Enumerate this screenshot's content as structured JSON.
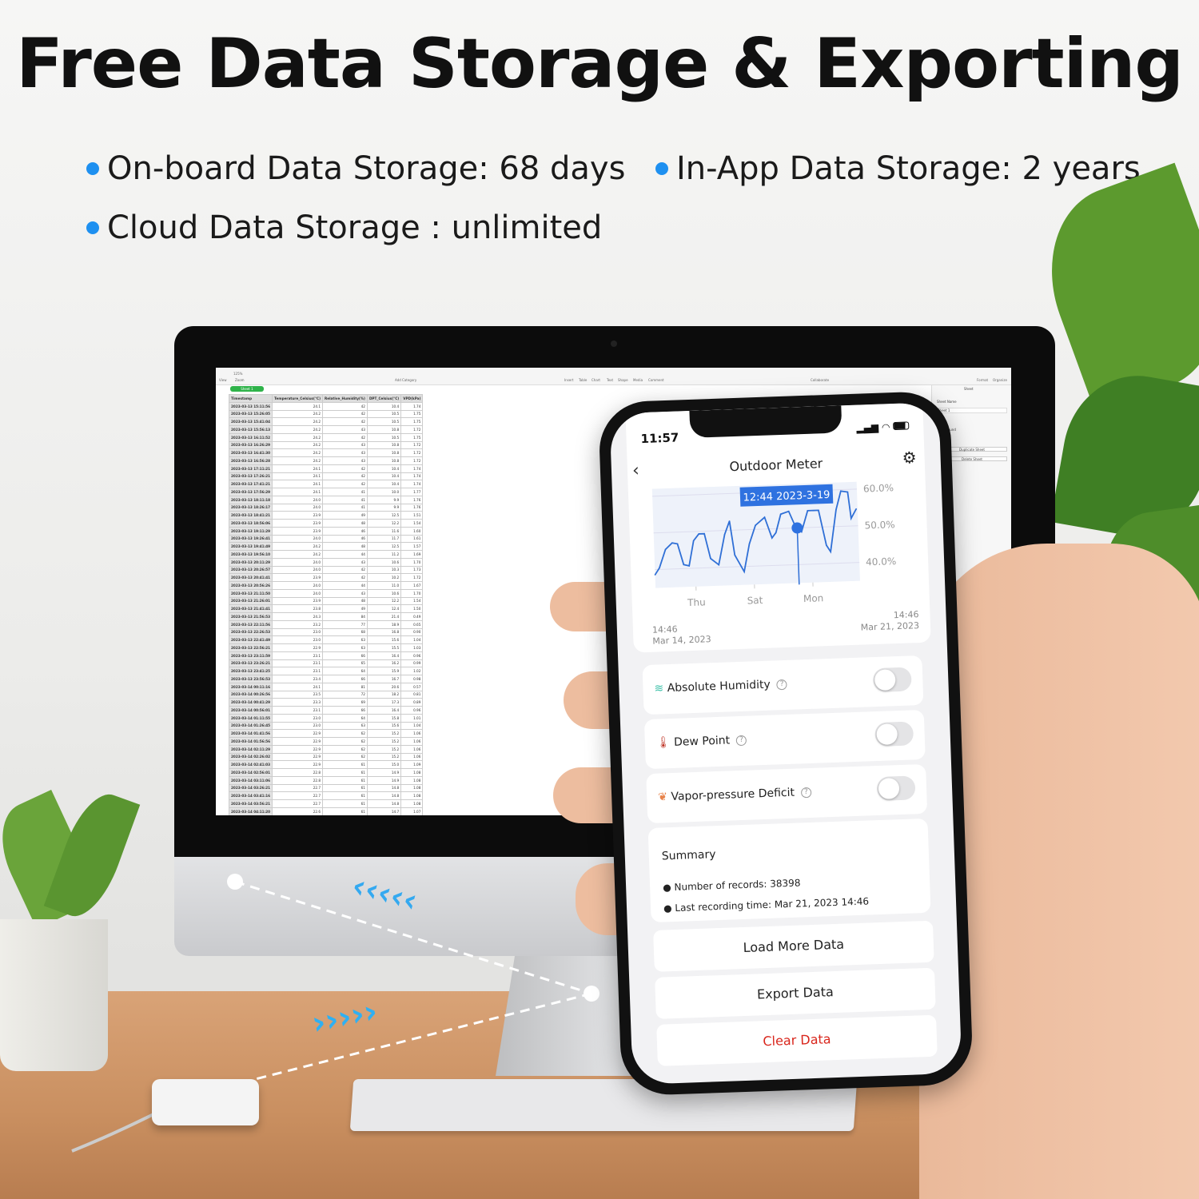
{
  "headline": "Free Data Storage & Exporting",
  "features": [
    "On-board Data Storage: 68 days",
    "In-App Data Storage: 2 years",
    "Cloud Data Storage : unlimited"
  ],
  "colors": {
    "accent": "#1e90f0",
    "chart_line": "#2f6fd6",
    "danger": "#d9261c",
    "toggle_off": "#e4e4e6"
  },
  "spreadsheet": {
    "toolbar": {
      "view": "View",
      "zoom_value": "125%",
      "zoom": "Zoom",
      "add_category": "Add Category",
      "insert": "Insert",
      "table": "Table",
      "chart": "Chart",
      "text": "Text",
      "shape": "Shape",
      "media": "Media",
      "comment": "Comment",
      "collaborate": "Collaborate",
      "format": "Format",
      "organize": "Organize"
    },
    "sheet_tab": "Sheet 1",
    "sidebar": {
      "title": "Sheet",
      "sheet_name_label": "Sheet Name",
      "sheet_name_value": "Sheet 1",
      "background": "Background",
      "duplicate": "Duplicate Sheet",
      "delete": "Delete Sheet"
    },
    "columns": [
      "Timestamp",
      "Temperature_Celsius(°C)",
      "Relative_Humidity(%)",
      "DPT_Celsius(°C)",
      "VPD(kPa)"
    ],
    "rows": [
      [
        "2023-03-13 15:11:56",
        "24.1",
        "42",
        "10.4",
        "1.74"
      ],
      [
        "2023-03-13 15:26:05",
        "24.2",
        "42",
        "10.5",
        "1.75"
      ],
      [
        "2023-03-13 15:41:04",
        "24.2",
        "42",
        "10.5",
        "1.75"
      ],
      [
        "2023-03-13 15:56:13",
        "24.2",
        "43",
        "10.8",
        "1.72"
      ],
      [
        "2023-03-13 16:11:52",
        "24.2",
        "42",
        "10.5",
        "1.75"
      ],
      [
        "2023-03-13 16:26:29",
        "24.2",
        "43",
        "10.8",
        "1.72"
      ],
      [
        "2023-03-13 16:41:30",
        "24.2",
        "43",
        "10.8",
        "1.72"
      ],
      [
        "2023-03-13 16:56:28",
        "24.2",
        "43",
        "10.8",
        "1.72"
      ],
      [
        "2023-03-13 17:11:21",
        "24.1",
        "42",
        "10.4",
        "1.74"
      ],
      [
        "2023-03-13 17:26:21",
        "24.1",
        "42",
        "10.4",
        "1.74"
      ],
      [
        "2023-03-13 17:41:21",
        "24.1",
        "42",
        "10.4",
        "1.74"
      ],
      [
        "2023-03-13 17:56:29",
        "24.1",
        "41",
        "10.0",
        "1.77"
      ],
      [
        "2023-03-13 18:11:18",
        "24.0",
        "41",
        "9.9",
        "1.76"
      ],
      [
        "2023-03-13 18:26:17",
        "24.0",
        "41",
        "9.9",
        "1.76"
      ],
      [
        "2023-03-13 18:41:21",
        "23.9",
        "49",
        "12.5",
        "1.51"
      ],
      [
        "2023-03-13 18:56:06",
        "23.9",
        "48",
        "12.2",
        "1.54"
      ],
      [
        "2023-03-13 19:11:29",
        "23.9",
        "46",
        "11.6",
        "1.60"
      ],
      [
        "2023-03-13 19:26:41",
        "24.0",
        "46",
        "11.7",
        "1.61"
      ],
      [
        "2023-03-13 19:41:49",
        "24.2",
        "48",
        "12.5",
        "1.57"
      ],
      [
        "2023-03-13 19:56:10",
        "24.2",
        "44",
        "11.2",
        "1.69"
      ],
      [
        "2023-03-13 20:11:29",
        "24.0",
        "43",
        "10.6",
        "1.70"
      ],
      [
        "2023-03-13 20:26:57",
        "24.0",
        "42",
        "10.3",
        "1.73"
      ],
      [
        "2023-03-13 20:41:41",
        "23.9",
        "42",
        "10.2",
        "1.72"
      ],
      [
        "2023-03-13 20:56:26",
        "24.0",
        "44",
        "11.0",
        "1.67"
      ],
      [
        "2023-03-13 21:11:50",
        "24.0",
        "43",
        "10.6",
        "1.70"
      ],
      [
        "2023-03-13 21:26:01",
        "23.9",
        "48",
        "12.2",
        "1.54"
      ],
      [
        "2023-03-13 21:41:41",
        "23.8",
        "49",
        "12.4",
        "1.50"
      ],
      [
        "2023-03-13 21:56:53",
        "24.3",
        "84",
        "21.4",
        "0.49"
      ],
      [
        "2023-03-13 22:11:56",
        "23.2",
        "77",
        "18.9",
        "0.65"
      ],
      [
        "2023-03-13 22:26:53",
        "23.0",
        "68",
        "16.8",
        "0.90"
      ],
      [
        "2023-03-13 22:41:49",
        "23.0",
        "63",
        "15.6",
        "1.04"
      ],
      [
        "2023-03-13 22:56:21",
        "22.9",
        "63",
        "15.5",
        "1.03"
      ],
      [
        "2023-03-13 23:11:59",
        "23.1",
        "66",
        "16.4",
        "0.96"
      ],
      [
        "2023-03-13 23:26:21",
        "23.1",
        "65",
        "16.2",
        "0.99"
      ],
      [
        "2023-03-13 23:41:25",
        "23.1",
        "64",
        "15.9",
        "1.02"
      ],
      [
        "2023-03-13 23:56:53",
        "23.4",
        "66",
        "16.7",
        "0.98"
      ],
      [
        "2023-03-14 00:11:16",
        "24.1",
        "81",
        "20.6",
        "0.57"
      ],
      [
        "2023-03-14 00:26:56",
        "23.5",
        "72",
        "18.2",
        "0.81"
      ],
      [
        "2023-03-14 00:41:29",
        "23.3",
        "69",
        "17.3",
        "0.89"
      ],
      [
        "2023-03-14 00:56:01",
        "23.1",
        "66",
        "16.4",
        "0.96"
      ],
      [
        "2023-03-14 01:11:55",
        "23.0",
        "64",
        "15.8",
        "1.01"
      ],
      [
        "2023-03-14 01:26:45",
        "23.0",
        "63",
        "15.6",
        "1.04"
      ],
      [
        "2023-03-14 01:41:56",
        "22.9",
        "62",
        "15.2",
        "1.06"
      ],
      [
        "2023-03-14 01:56:56",
        "22.9",
        "62",
        "15.2",
        "1.06"
      ],
      [
        "2023-03-14 02:11:29",
        "22.9",
        "62",
        "15.2",
        "1.06"
      ],
      [
        "2023-03-14 02:26:02",
        "22.9",
        "62",
        "15.2",
        "1.06"
      ],
      [
        "2023-03-14 02:41:03",
        "22.9",
        "61",
        "15.0",
        "1.09"
      ],
      [
        "2023-03-14 02:56:01",
        "22.8",
        "61",
        "14.9",
        "1.08"
      ],
      [
        "2023-03-14 03:11:06",
        "22.8",
        "61",
        "14.9",
        "1.08"
      ],
      [
        "2023-03-14 03:26:21",
        "22.7",
        "61",
        "14.8",
        "1.08"
      ],
      [
        "2023-03-14 03:41:16",
        "22.7",
        "61",
        "14.8",
        "1.08"
      ],
      [
        "2023-03-14 03:56:21",
        "22.7",
        "61",
        "14.8",
        "1.08"
      ],
      [
        "2023-03-14 04:11:20",
        "22.6",
        "61",
        "14.7",
        "1.07"
      ]
    ]
  },
  "phone": {
    "status_time": "11:57",
    "title": "Outdoor Meter",
    "icons": {
      "back": "chevron-left-icon",
      "settings": "gear-icon"
    },
    "range_start": {
      "time": "14:46",
      "date": "Mar 14, 2023"
    },
    "range_end": {
      "time": "14:46",
      "date": "Mar 21, 2023"
    },
    "toggles": [
      {
        "label": "Absolute Humidity",
        "icon": "humidity-wind-icon",
        "on": false
      },
      {
        "label": "Dew Point",
        "icon": "dew-point-thermometer-icon",
        "on": false
      },
      {
        "label": "Vapor-pressure Deficit",
        "icon": "leaf-icon",
        "on": false
      }
    ],
    "summary": {
      "title": "Summary",
      "records_label": "Number of records:",
      "records_value": "38398",
      "last_label": "Last recording time:",
      "last_value": "Mar 21, 2023 14:46"
    },
    "buttons": {
      "load_more": "Load More Data",
      "export": "Export Data",
      "clear": "Clear Data"
    }
  },
  "chart_data": {
    "type": "line",
    "title": "",
    "xlabel": "",
    "ylabel": "",
    "x_ticks": [
      {
        "label": "Thu",
        "date": "2023-03-16 00:00"
      },
      {
        "label": "Sat",
        "date": "2023-03-18 00:00"
      },
      {
        "label": "Mon",
        "date": "2023-03-20 00:00"
      }
    ],
    "y_ticks": [
      "60.0%",
      "50.0%",
      "40.0%"
    ],
    "y_tick_values": [
      60,
      50,
      40
    ],
    "xlim": [
      "2023-03-14 14:46",
      "2023-03-21 14:46"
    ],
    "ylim": [
      35,
      62
    ],
    "grid": true,
    "tooltip": {
      "label": "12:44 2023-3-19",
      "date": "2023-03-19 12:44",
      "value": 50.0
    },
    "series": [
      {
        "points": [
          [
            "2023-03-14 14:46",
            38.6
          ],
          [
            "2023-03-14 18:30",
            40.4
          ],
          [
            "2023-03-15 00:00",
            45.4
          ],
          [
            "2023-03-15 05:40",
            47.1
          ],
          [
            "2023-03-15 10:00",
            46.8
          ],
          [
            "2023-03-15 14:30",
            41.1
          ],
          [
            "2023-03-15 19:00",
            40.7
          ],
          [
            "2023-03-15 23:20",
            47.5
          ],
          [
            "2023-03-16 03:50",
            49.3
          ],
          [
            "2023-03-16 08:20",
            49.3
          ],
          [
            "2023-03-16 12:45",
            42.5
          ],
          [
            "2023-03-16 19:20",
            40.7
          ],
          [
            "2023-03-17 01:00",
            48.9
          ],
          [
            "2023-03-17 05:20",
            52.5
          ],
          [
            "2023-03-17 08:45",
            43.2
          ],
          [
            "2023-03-17 16:00",
            38.6
          ],
          [
            "2023-03-17 21:00",
            46.1
          ],
          [
            "2023-03-18 02:30",
            51.1
          ],
          [
            "2023-03-18 10:15",
            53.2
          ],
          [
            "2023-03-18 15:45",
            47.5
          ],
          [
            "2023-03-18 19:05",
            48.9
          ],
          [
            "2023-03-18 23:35",
            53.9
          ],
          [
            "2023-03-19 06:10",
            54.6
          ],
          [
            "2023-03-19 11:45",
            50.0
          ],
          [
            "2023-03-19 16:10",
            48.9
          ],
          [
            "2023-03-19 21:45",
            54.6
          ],
          [
            "2023-03-20 06:40",
            54.6
          ],
          [
            "2023-03-20 12:10",
            45.0
          ],
          [
            "2023-03-20 15:30",
            43.2
          ],
          [
            "2023-03-20 21:05",
            54.6
          ],
          [
            "2023-03-21 01:30",
            59.6
          ],
          [
            "2023-03-21 07:05",
            59.3
          ],
          [
            "2023-03-21 09:15",
            52.1
          ],
          [
            "2023-03-21 13:40",
            54.6
          ]
        ]
      }
    ]
  }
}
